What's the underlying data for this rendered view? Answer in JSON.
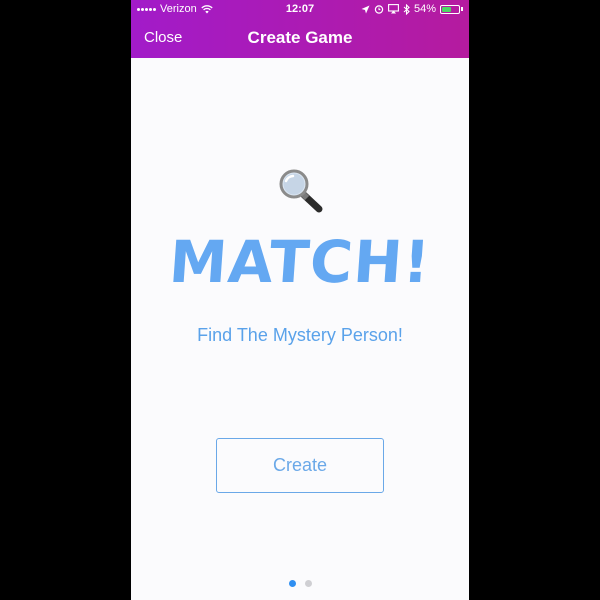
{
  "status_bar": {
    "carrier": "Verizon",
    "time": "12:07",
    "battery_percent": "54%",
    "battery_level": 0.54,
    "icons": [
      "signal-icon",
      "wifi-icon",
      "location-icon",
      "alarm-icon",
      "screen-mirror-icon",
      "bluetooth-icon",
      "battery-icon"
    ]
  },
  "nav": {
    "close_label": "Close",
    "title": "Create Game"
  },
  "main": {
    "icon": "magnifying-glass-icon",
    "title": "MATCH!",
    "subtitle": "Find The Mystery Person!",
    "create_label": "Create"
  },
  "pager": {
    "count": 2,
    "active_index": 0
  },
  "colors": {
    "header_start": "#a21bc9",
    "header_end": "#b51b9f",
    "accent_blue": "#64a8f2",
    "dot_active": "#2f8ff1",
    "dot_inactive": "#cfcfd3",
    "background": "#fbfbfd"
  }
}
